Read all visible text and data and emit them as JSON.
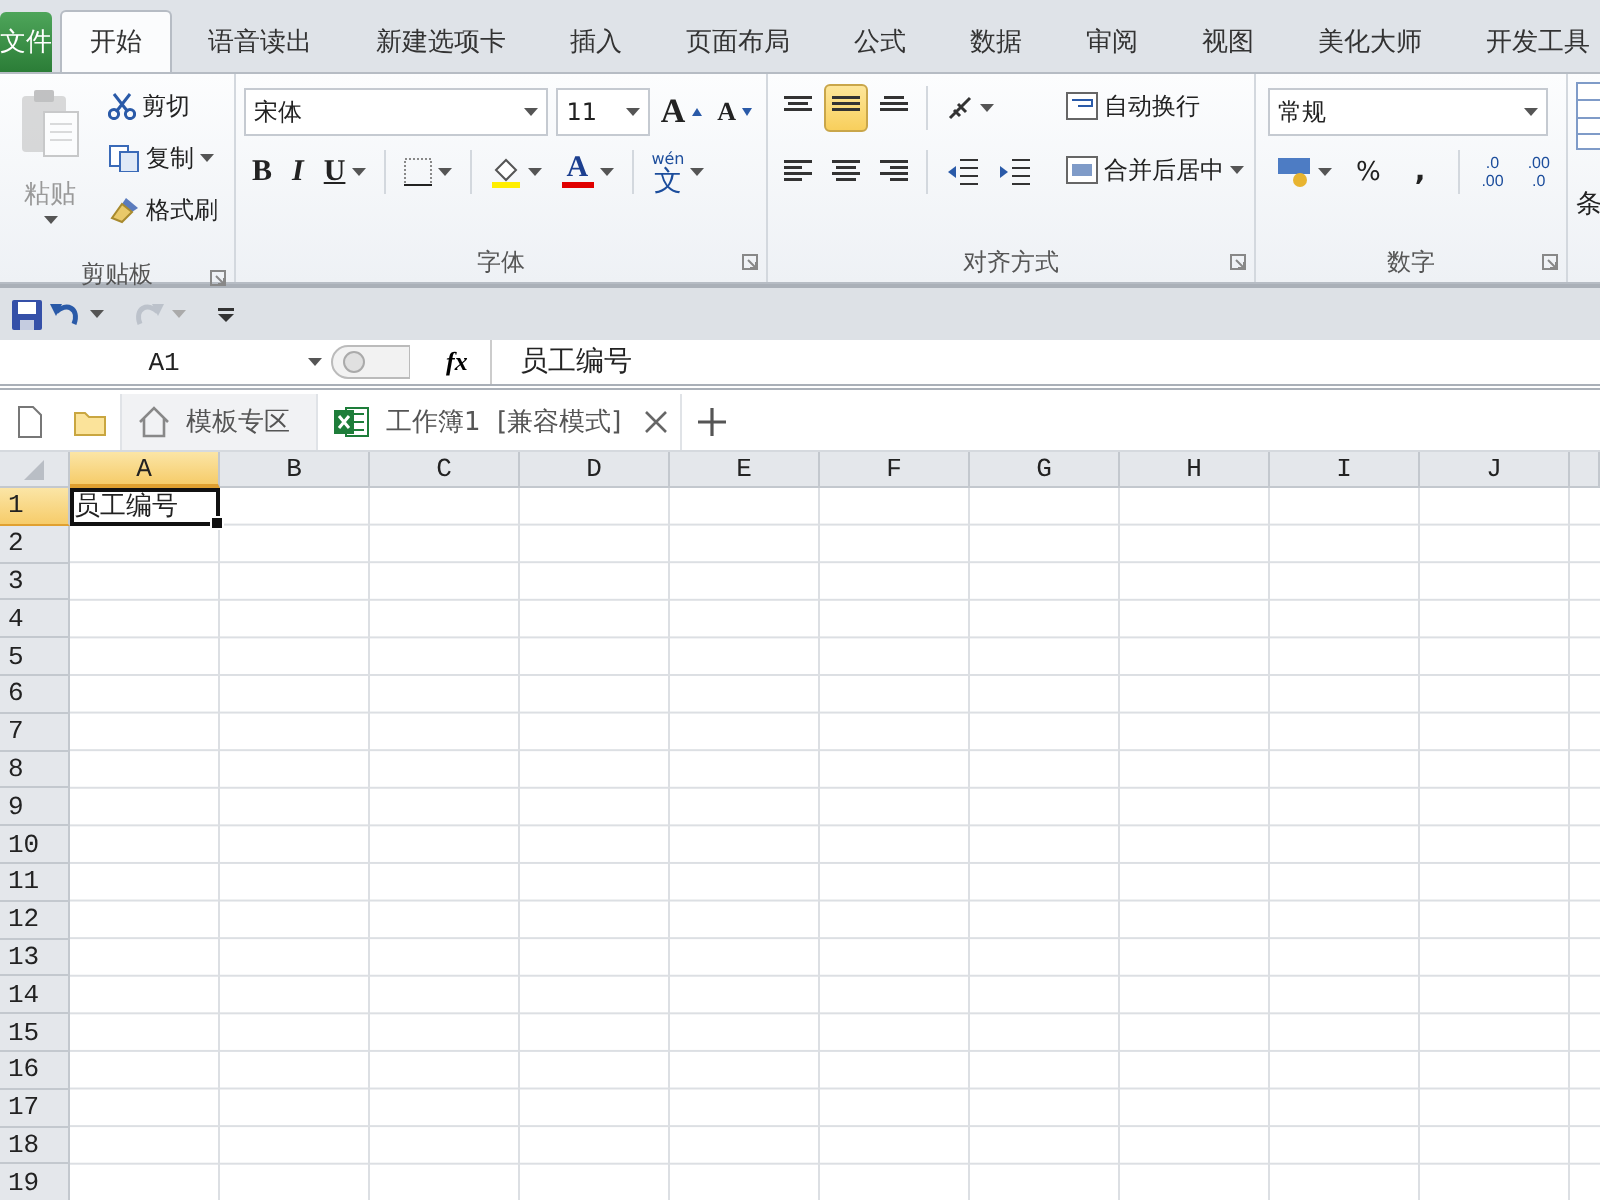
{
  "tabs": [
    {
      "label": "文件",
      "kind": "file",
      "selected": false
    },
    {
      "label": "开始",
      "kind": "tab",
      "selected": true
    },
    {
      "label": "语音读出",
      "kind": "tab",
      "selected": false
    },
    {
      "label": "新建选项卡",
      "kind": "tab",
      "selected": false
    },
    {
      "label": "插入",
      "kind": "tab",
      "selected": false
    },
    {
      "label": "页面布局",
      "kind": "tab",
      "selected": false
    },
    {
      "label": "公式",
      "kind": "tab",
      "selected": false
    },
    {
      "label": "数据",
      "kind": "tab",
      "selected": false
    },
    {
      "label": "审阅",
      "kind": "tab",
      "selected": false
    },
    {
      "label": "视图",
      "kind": "tab",
      "selected": false
    },
    {
      "label": "美化大师",
      "kind": "tab",
      "selected": false
    },
    {
      "label": "开发工具",
      "kind": "tab",
      "selected": false
    }
  ],
  "clipboard": {
    "title": "剪贴板",
    "paste": "粘贴",
    "paste_disabled": true,
    "cut": "剪切",
    "copy": "复制",
    "format_painter": "格式刷"
  },
  "font": {
    "title": "字体",
    "name": "宋体",
    "size": "11",
    "grow": "A",
    "shrink": "A",
    "bold": "B",
    "italic": "I",
    "underline": "U",
    "font_color": "A",
    "phonetic_top": "wén",
    "phonetic": "文"
  },
  "alignment": {
    "title": "对齐方式",
    "vertical": [
      {
        "selected": false
      },
      {
        "selected": true
      },
      {
        "selected": false
      }
    ],
    "wrap": "自动换行",
    "merge": "合并后居中"
  },
  "number": {
    "title": "数字",
    "format": "常规",
    "percent": "%",
    "comma": ",",
    "decimal_increase": {
      "top": ".0",
      "bottom": ".00"
    },
    "decimal_decrease": {
      "top": ".00",
      "bottom": ".0"
    }
  },
  "next_group": {
    "label": "条"
  },
  "formula_bar": {
    "name_box": "A1",
    "fx": "fx",
    "content": "员工编号"
  },
  "doc_tabs": [
    {
      "label": "模板专区",
      "kind": "home",
      "selected": false
    },
    {
      "label": "工作簿1  [兼容模式]",
      "kind": "workbook",
      "selected": true
    }
  ],
  "sheet": {
    "columns": [
      {
        "label": "A",
        "selected": true
      },
      {
        "label": "B",
        "selected": false
      },
      {
        "label": "C",
        "selected": false
      },
      {
        "label": "D",
        "selected": false
      },
      {
        "label": "E",
        "selected": false
      },
      {
        "label": "F",
        "selected": false
      },
      {
        "label": "G",
        "selected": false
      },
      {
        "label": "H",
        "selected": false
      },
      {
        "label": "I",
        "selected": false
      },
      {
        "label": "J",
        "selected": false
      }
    ],
    "rows": [
      {
        "label": "1",
        "selected": true,
        "cells": [
          {
            "value": "员工编号",
            "selected": true
          }
        ]
      },
      {
        "label": "2",
        "selected": false
      },
      {
        "label": "3",
        "selected": false
      },
      {
        "label": "4",
        "selected": false
      },
      {
        "label": "5",
        "selected": false
      },
      {
        "label": "6",
        "selected": false
      },
      {
        "label": "7",
        "selected": false
      },
      {
        "label": "8",
        "selected": false
      },
      {
        "label": "9",
        "selected": false
      },
      {
        "label": "10",
        "selected": false
      },
      {
        "label": "11",
        "selected": false
      },
      {
        "label": "12",
        "selected": false
      },
      {
        "label": "13",
        "selected": false
      },
      {
        "label": "14",
        "selected": false
      },
      {
        "label": "15",
        "selected": false
      },
      {
        "label": "16",
        "selected": false
      },
      {
        "label": "17",
        "selected": false
      },
      {
        "label": "18",
        "selected": false
      },
      {
        "label": "19",
        "selected": false
      }
    ]
  }
}
